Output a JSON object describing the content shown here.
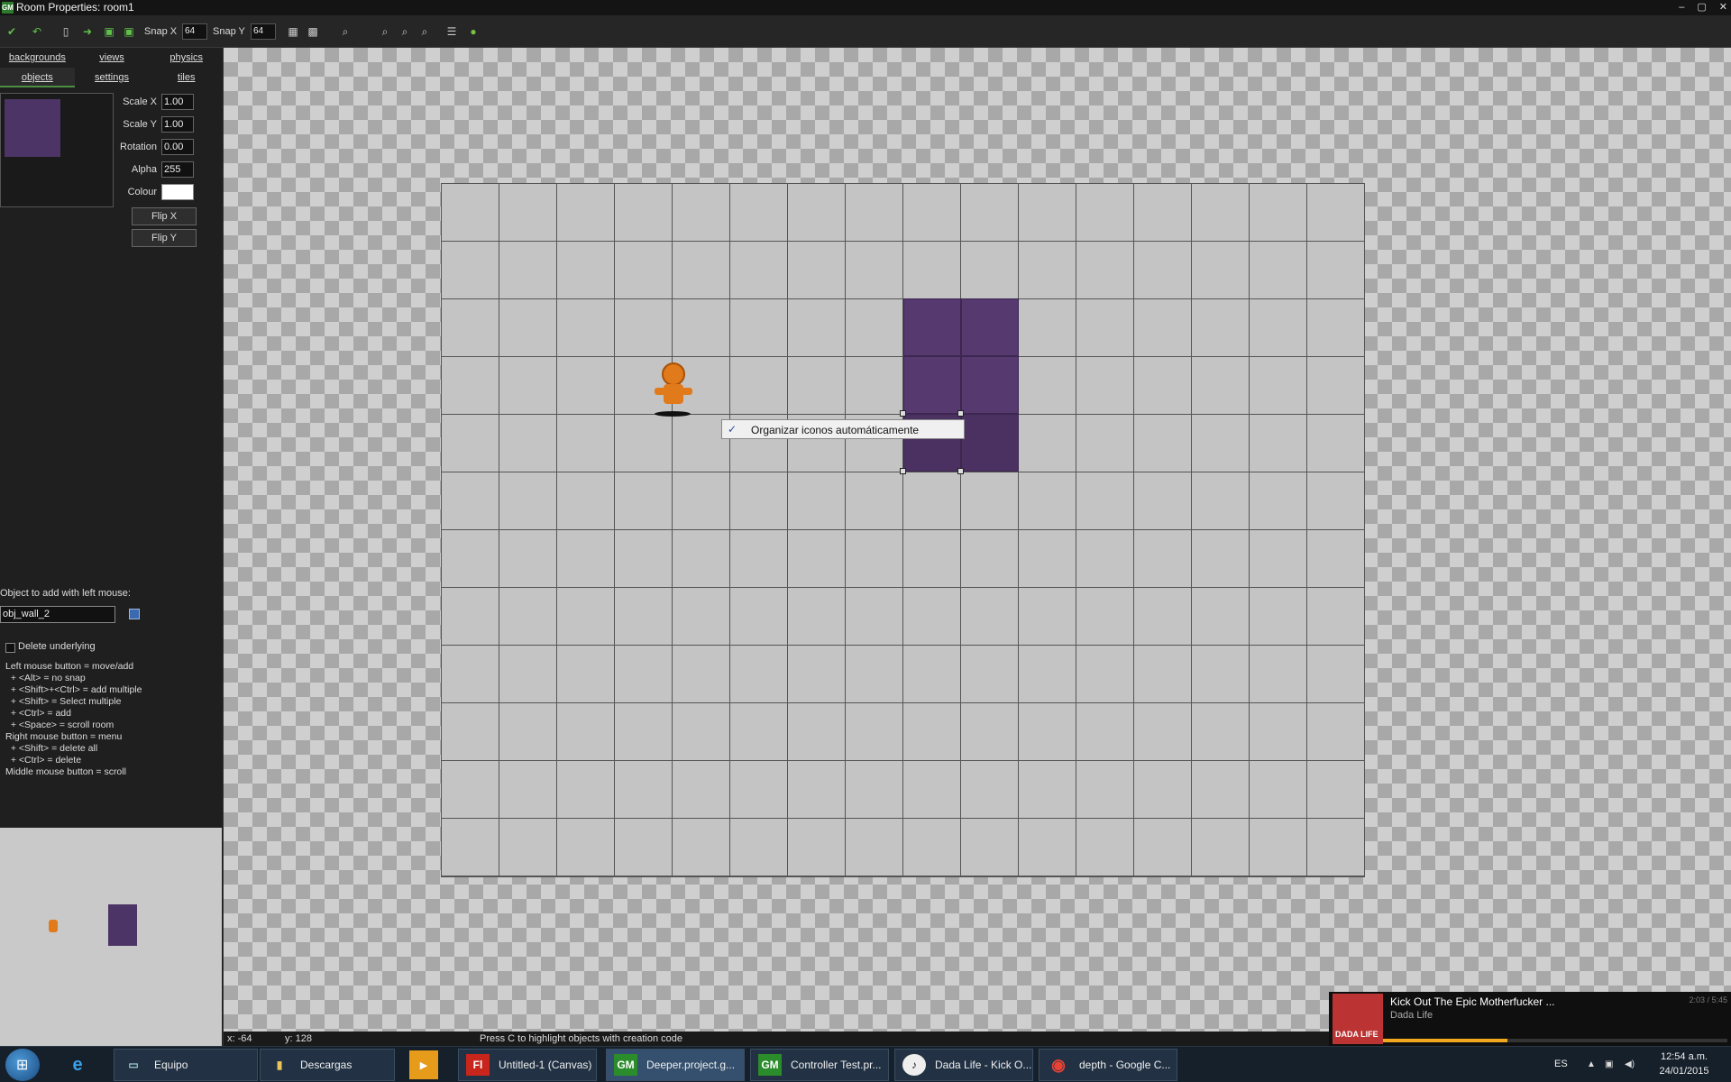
{
  "window": {
    "title": "Room Properties: room1",
    "controls": [
      "–",
      "▢",
      "✕"
    ]
  },
  "toolbar": {
    "snap_x_label": "Snap X",
    "snap_x_value": "64",
    "snap_y_label": "Snap Y",
    "snap_y_value": "64"
  },
  "tabs": {
    "row1": [
      "backgrounds",
      "views",
      "physics"
    ],
    "row2": [
      "objects",
      "settings",
      "tiles"
    ],
    "active": "objects"
  },
  "instance": {
    "scale_x_label": "Scale X",
    "scale_x": "1.00",
    "scale_y_label": "Scale Y",
    "scale_y": "1.00",
    "rotation_label": "Rotation",
    "rotation": "0.00",
    "alpha_label": "Alpha",
    "alpha": "255",
    "colour_label": "Colour",
    "colour": "#ffffff",
    "flip_x": "Flip X",
    "flip_y": "Flip Y"
  },
  "object_add": {
    "label": "Object to add with left mouse:",
    "value": "obj_wall_2",
    "delete_underlying": "Delete underlying"
  },
  "help_text": "Left mouse button = move/add\n  + <Alt> = no snap\n  + <Shift>+<Ctrl> = add multiple\n  + <Shift> = Select multiple\n  + <Ctrl> = add\n  + <Space> = scroll room\nRight mouse button = menu\n  + <Shift> = delete all\n  + <Ctrl> = delete\nMiddle mouse button = scroll",
  "context_menu": {
    "item": "Organizar iconos automáticamente",
    "checked": true
  },
  "status": {
    "x": "x: -64",
    "y": "y: 128",
    "hint": "Press C to highlight objects with creation code"
  },
  "now_playing": {
    "title": "Kick Out The Epic Motherfucker ...",
    "artist": "Dada Life",
    "time": "2:03 / 5:45",
    "art_label": "DADA LIFE",
    "progress": 0.36
  },
  "taskbar": {
    "tasks": [
      {
        "label": "Equipo",
        "icon": "computer-icon"
      },
      {
        "label": "Descargas",
        "icon": "folder-icon"
      },
      {
        "label": "Untitled-1 (Canvas)",
        "icon": "flash-icon",
        "icon_text": "Fl"
      },
      {
        "label": "Deeper.project.g...",
        "icon": "gamemaker-icon",
        "icon_text": "GM"
      },
      {
        "label": "Controller Test.pr...",
        "icon": "gamemaker-icon",
        "icon_text": "GM"
      },
      {
        "label": "Dada Life - Kick O...",
        "icon": "music-player-icon",
        "icon_text": "♪"
      },
      {
        "label": "depth - Google C...",
        "icon": "chrome-icon",
        "icon_text": "◉"
      }
    ],
    "tray": {
      "lang": "ES",
      "time": "12:54 a.m.",
      "date": "24/01/2015"
    }
  },
  "colors": {
    "wall": "#56396f",
    "player": "#e07a1a",
    "accent": "#4e8e44"
  }
}
